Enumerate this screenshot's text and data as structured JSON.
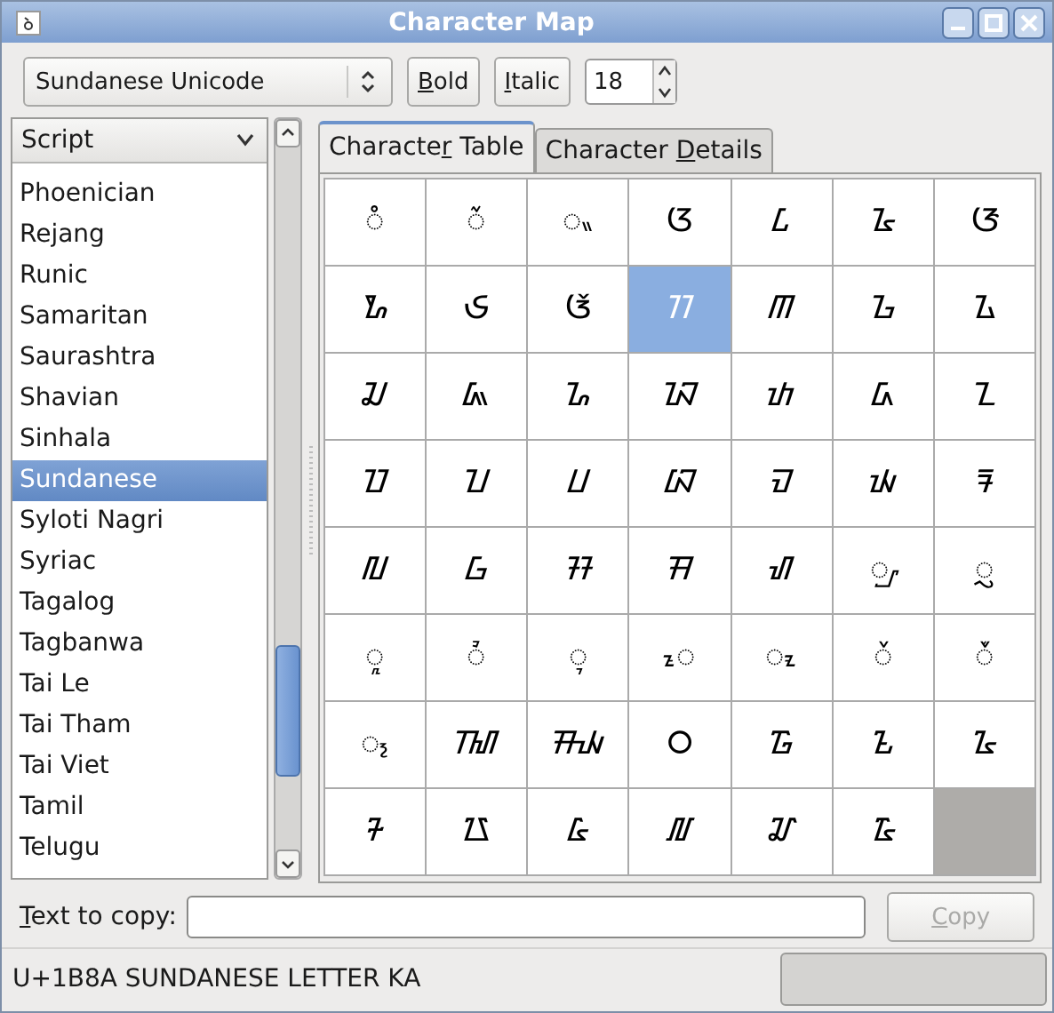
{
  "window": {
    "title": "Character Map"
  },
  "toolbar": {
    "font": "Sundanese Unicode",
    "bold": {
      "key": "B",
      "post": "old"
    },
    "italic": {
      "key": "I",
      "post": "talic"
    },
    "size": "18"
  },
  "script_list": {
    "header": "Script",
    "items": [
      {
        "label": "Phoenician",
        "selected": false
      },
      {
        "label": "Rejang",
        "selected": false
      },
      {
        "label": "Runic",
        "selected": false
      },
      {
        "label": "Samaritan",
        "selected": false
      },
      {
        "label": "Saurashtra",
        "selected": false
      },
      {
        "label": "Shavian",
        "selected": false
      },
      {
        "label": "Sinhala",
        "selected": false
      },
      {
        "label": "Sundanese",
        "selected": true
      },
      {
        "label": "Syloti Nagri",
        "selected": false
      },
      {
        "label": "Syriac",
        "selected": false
      },
      {
        "label": "Tagalog",
        "selected": false
      },
      {
        "label": "Tagbanwa",
        "selected": false
      },
      {
        "label": "Tai Le",
        "selected": false
      },
      {
        "label": "Tai Tham",
        "selected": false
      },
      {
        "label": "Tai Viet",
        "selected": false
      },
      {
        "label": "Tamil",
        "selected": false
      },
      {
        "label": "Telugu",
        "selected": false
      }
    ]
  },
  "tabs": [
    {
      "pre": "Characte",
      "key": "r",
      "post": " Table",
      "selected": true
    },
    {
      "pre": "Character ",
      "key": "D",
      "post": "etails",
      "selected": false
    }
  ],
  "characters": [
    {
      "char": "ᮀ",
      "selected": false
    },
    {
      "char": "ᮁ",
      "selected": false
    },
    {
      "char": "ᮂ",
      "selected": false
    },
    {
      "char": "ᮃ",
      "selected": false
    },
    {
      "char": "ᮄ",
      "selected": false
    },
    {
      "char": "ᮅ",
      "selected": false
    },
    {
      "char": "ᮆ",
      "selected": false
    },
    {
      "char": "ᮇ",
      "selected": false
    },
    {
      "char": "ᮈ",
      "selected": false
    },
    {
      "char": "ᮉ",
      "selected": false
    },
    {
      "char": "ᮊ",
      "selected": true
    },
    {
      "char": "ᮋ",
      "selected": false
    },
    {
      "char": "ᮌ",
      "selected": false
    },
    {
      "char": "ᮍ",
      "selected": false
    },
    {
      "char": "ᮎ",
      "selected": false
    },
    {
      "char": "ᮏ",
      "selected": false
    },
    {
      "char": "ᮐ",
      "selected": false
    },
    {
      "char": "ᮑ",
      "selected": false
    },
    {
      "char": "ᮒ",
      "selected": false
    },
    {
      "char": "ᮓ",
      "selected": false
    },
    {
      "char": "ᮔ",
      "selected": false
    },
    {
      "char": "ᮕ",
      "selected": false
    },
    {
      "char": "ᮖ",
      "selected": false
    },
    {
      "char": "ᮗ",
      "selected": false
    },
    {
      "char": "ᮘ",
      "selected": false
    },
    {
      "char": "ᮙ",
      "selected": false
    },
    {
      "char": "ᮚ",
      "selected": false
    },
    {
      "char": "ᮛ",
      "selected": false
    },
    {
      "char": "ᮜ",
      "selected": false
    },
    {
      "char": "ᮝ",
      "selected": false
    },
    {
      "char": "ᮞ",
      "selected": false
    },
    {
      "char": "ᮟ",
      "selected": false
    },
    {
      "char": "ᮠ",
      "selected": false
    },
    {
      "char": "ᮡ",
      "selected": false
    },
    {
      "char": "ᮢ",
      "selected": false
    },
    {
      "char": "ᮣ",
      "selected": false
    },
    {
      "char": "ᮤ",
      "selected": false
    },
    {
      "char": "ᮥ",
      "selected": false
    },
    {
      "char": "ᮦ",
      "selected": false
    },
    {
      "char": "ᮧ",
      "selected": false
    },
    {
      "char": "ᮨ",
      "selected": false
    },
    {
      "char": "ᮩ",
      "selected": false
    },
    {
      "char": "᮪",
      "selected": false
    },
    {
      "char": "ᮮ",
      "selected": false
    },
    {
      "char": "ᮯ",
      "selected": false
    },
    {
      "char": "᮰",
      "selected": false
    },
    {
      "char": "᮱",
      "selected": false
    },
    {
      "char": "᮲",
      "selected": false
    },
    {
      "char": "᮳",
      "selected": false
    },
    {
      "char": "᮴",
      "selected": false
    },
    {
      "char": "᮵",
      "selected": false
    },
    {
      "char": "᮶",
      "selected": false
    },
    {
      "char": "᮷",
      "selected": false
    },
    {
      "char": "᮸",
      "selected": false
    },
    {
      "char": "᮹",
      "selected": false
    }
  ],
  "copy_row": {
    "label": {
      "key": "T",
      "post": "ext to copy:"
    },
    "button": {
      "key": "C",
      "post": "opy",
      "disabled": true
    }
  },
  "status_bar": {
    "text": "U+1B8A SUNDANESE LETTER KA"
  }
}
